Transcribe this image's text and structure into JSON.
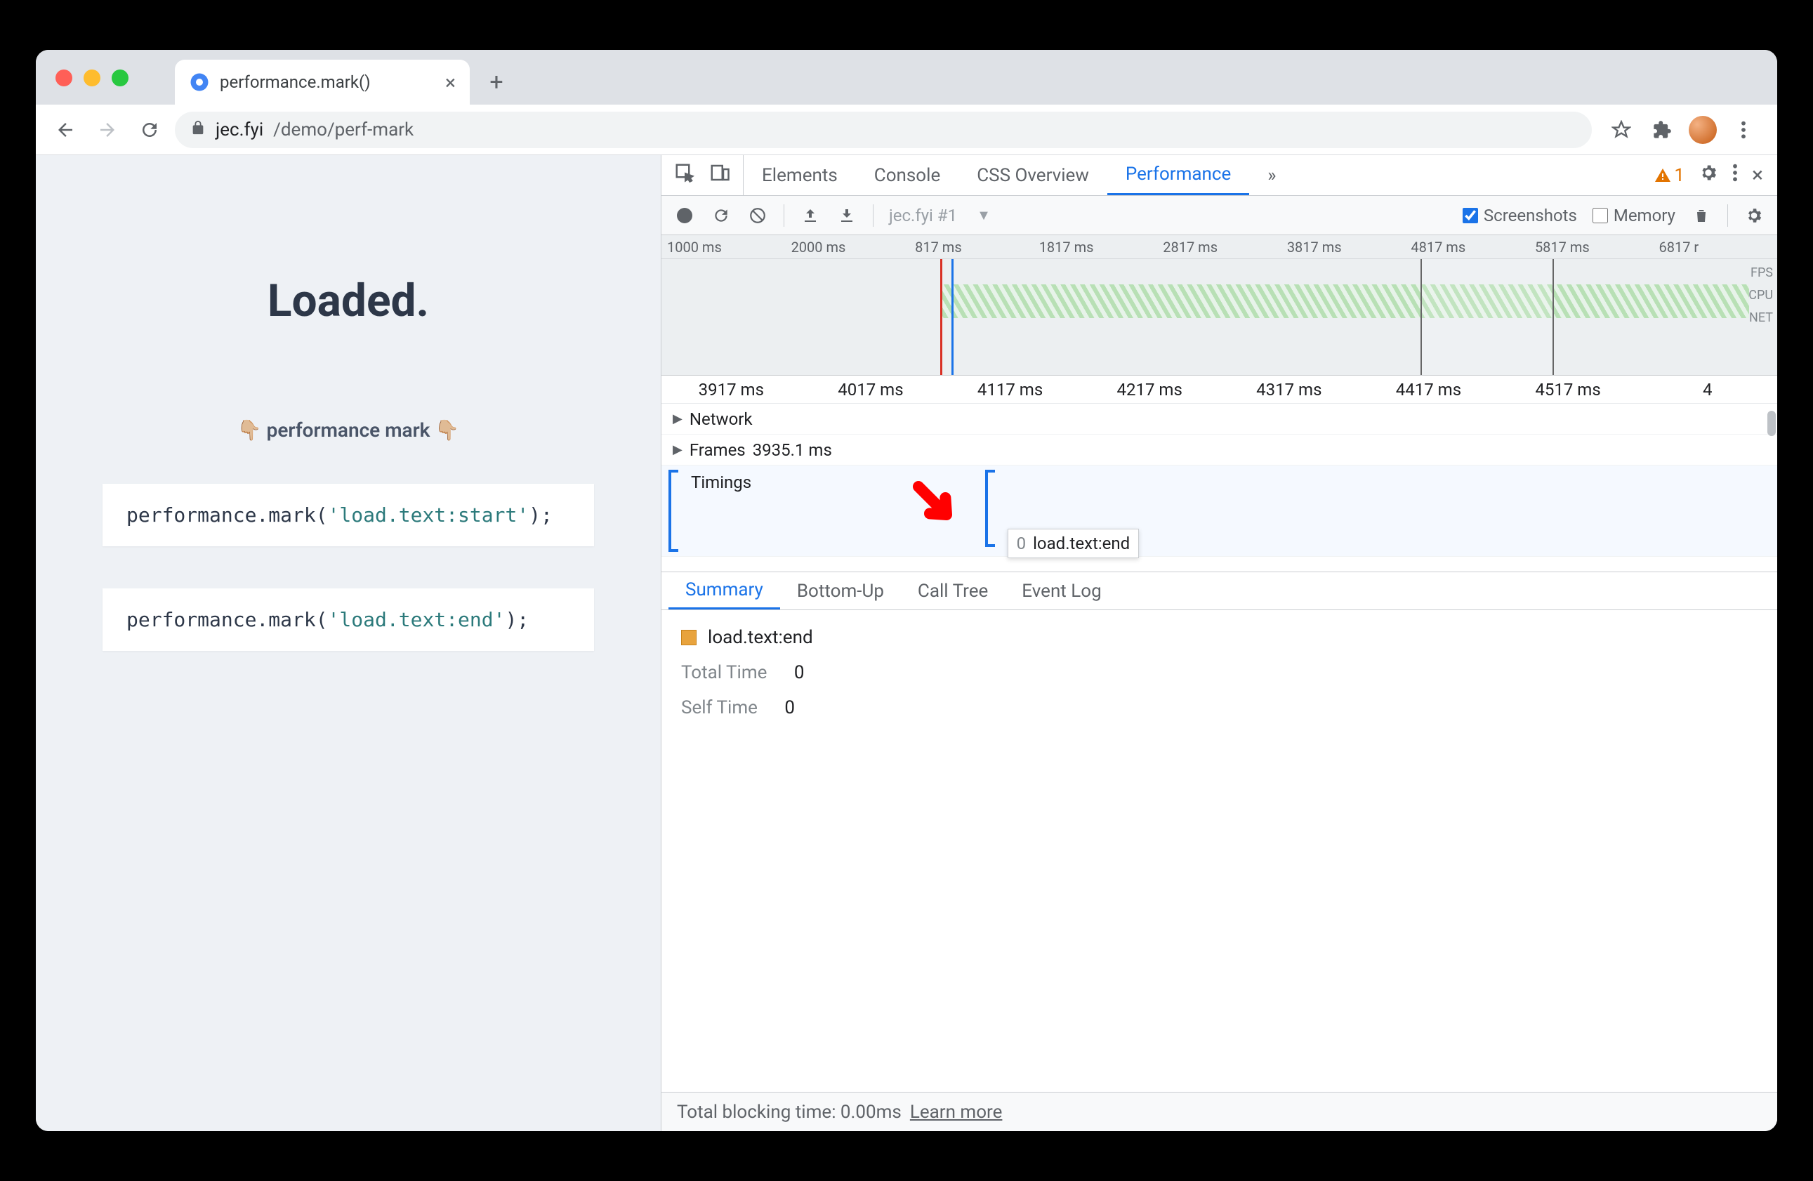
{
  "browser": {
    "tab_title": "performance.mark()",
    "url_display_host": "jec.fyi",
    "url_display_path": "/demo/perf-mark"
  },
  "page": {
    "heading": "Loaded.",
    "subheading": "👇🏼 performance mark 👇🏼",
    "code_lines": [
      {
        "func": "performance.mark(",
        "arg": "'load.text:start'",
        "tail": ");"
      },
      {
        "func": "performance.mark(",
        "arg": "'load.text:end'",
        "tail": ");"
      }
    ]
  },
  "devtools": {
    "tabs": [
      "Elements",
      "Console",
      "CSS Overview",
      "Performance"
    ],
    "more_tabs_icon": "»",
    "warning_count": "1",
    "toolbar": {
      "capture_label": "jec.fyi #1",
      "screenshots_label": "Screenshots",
      "memory_label": "Memory"
    },
    "overview": {
      "ticks": [
        "1000 ms",
        "2000 ms",
        "817 ms",
        "1817 ms",
        "2817 ms",
        "3817 ms",
        "4817 ms",
        "5817 ms",
        "6817 r"
      ],
      "lanes": [
        "FPS",
        "CPU",
        "NET"
      ]
    },
    "flame": {
      "ticks": [
        "3917 ms",
        "4017 ms",
        "4117 ms",
        "4217 ms",
        "4317 ms",
        "4417 ms",
        "4517 ms",
        "4"
      ],
      "rows": {
        "network": "Network",
        "frames": "Frames",
        "frames_value": "3935.1 ms",
        "timings": "Timings"
      },
      "tooltip": {
        "count": "0",
        "label": "load.text:end"
      }
    },
    "detail_tabs": [
      "Summary",
      "Bottom-Up",
      "Call Tree",
      "Event Log"
    ],
    "summary": {
      "event_name": "load.text:end",
      "rows": [
        {
          "label": "Total Time",
          "value": "0"
        },
        {
          "label": "Self Time",
          "value": "0"
        }
      ]
    },
    "footer": {
      "text": "Total blocking time: 0.00ms",
      "link": "Learn more"
    }
  }
}
